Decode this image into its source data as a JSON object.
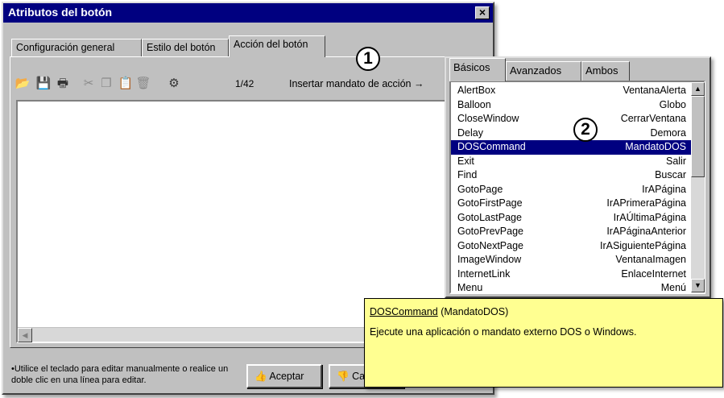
{
  "dialog": {
    "title": "Atributos del botón",
    "close_glyph": "×",
    "tabs": [
      {
        "label": "Configuración general",
        "active": false
      },
      {
        "label": "Estilo del botón",
        "active": false
      },
      {
        "label": "Acción del botón",
        "active": true
      }
    ],
    "toolbar": {
      "icons": [
        "open-icon",
        "save-icon",
        "print-icon",
        "cut-icon",
        "copy-icon",
        "paste-icon",
        "delete-icon",
        "settings-icon"
      ],
      "page_count": "1/42",
      "insert_label": "Insertar mandato de acción →"
    },
    "hint": "•Utilice el teclado para editar manualmente o realice un doble clic en una línea para editar.",
    "buttons": {
      "ok": "Aceptar",
      "cancel": "Ca"
    }
  },
  "callouts": {
    "one": "1",
    "two": "2"
  },
  "popup": {
    "tabs": [
      {
        "label": "Básicos",
        "active": true
      },
      {
        "label": "Avanzados",
        "active": false
      },
      {
        "label": "Ambos",
        "active": false
      }
    ],
    "commands": [
      {
        "en": "AlertBox",
        "es": "VentanaAlerta"
      },
      {
        "en": "Balloon",
        "es": "Globo"
      },
      {
        "en": "CloseWindow",
        "es": "CerrarVentana"
      },
      {
        "en": "Delay",
        "es": "Demora"
      },
      {
        "en": "DOSCommand",
        "es": "MandatoDOS",
        "selected": true
      },
      {
        "en": "Exit",
        "es": "Salir"
      },
      {
        "en": "Find",
        "es": "Buscar"
      },
      {
        "en": "GotoPage",
        "es": "IrAPágina"
      },
      {
        "en": "GotoFirstPage",
        "es": "IrAPrimeraPágina"
      },
      {
        "en": "GotoLastPage",
        "es": "IrAÚltimaPágina"
      },
      {
        "en": "GotoPrevPage",
        "es": "IrAPáginaAnterior"
      },
      {
        "en": "GotoNextPage",
        "es": "IrASiguientePágina"
      },
      {
        "en": "ImageWindow",
        "es": "VentanaImagen"
      },
      {
        "en": "InternetLink",
        "es": "EnlaceInternet"
      },
      {
        "en": "Menu",
        "es": "Menú"
      }
    ]
  },
  "tooltip": {
    "command": "DOSCommand",
    "translation": " (MandatoDOS)",
    "description": "Ejecute una aplicación o mandato externo DOS o Windows."
  }
}
